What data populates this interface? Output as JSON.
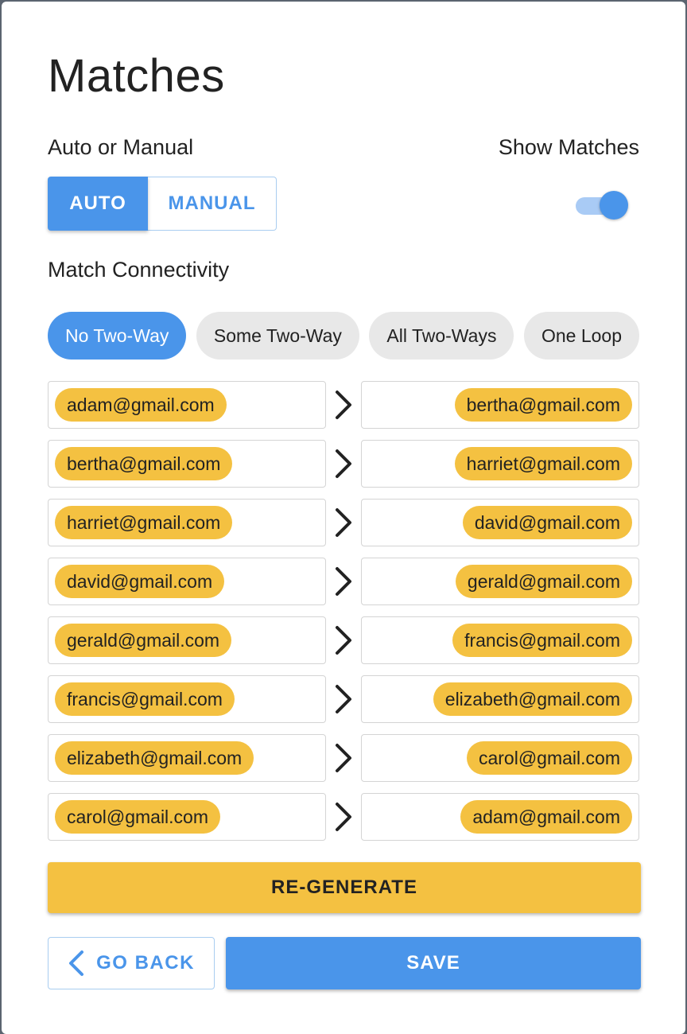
{
  "title": "Matches",
  "mode": {
    "label": "Auto or Manual",
    "auto_label": "AUTO",
    "manual_label": "MANUAL",
    "selected": "AUTO"
  },
  "show_matches": {
    "label": "Show Matches",
    "enabled": true
  },
  "connectivity": {
    "label": "Match Connectivity",
    "options": [
      "No Two-Way",
      "Some Two-Way",
      "All Two-Ways",
      "One Loop"
    ],
    "selected": "No Two-Way"
  },
  "matches": [
    {
      "from": "adam@gmail.com",
      "to": "bertha@gmail.com"
    },
    {
      "from": "bertha@gmail.com",
      "to": "harriet@gmail.com"
    },
    {
      "from": "harriet@gmail.com",
      "to": "david@gmail.com"
    },
    {
      "from": "david@gmail.com",
      "to": "gerald@gmail.com"
    },
    {
      "from": "gerald@gmail.com",
      "to": "francis@gmail.com"
    },
    {
      "from": "francis@gmail.com",
      "to": "elizabeth@gmail.com"
    },
    {
      "from": "elizabeth@gmail.com",
      "to": "carol@gmail.com"
    },
    {
      "from": "carol@gmail.com",
      "to": "adam@gmail.com"
    }
  ],
  "actions": {
    "regenerate_label": "RE-GENERATE",
    "go_back_label": "GO BACK",
    "save_label": "SAVE"
  },
  "colors": {
    "primary": "#4a95ea",
    "accent": "#f4c141",
    "chip_inactive": "#e8e8e8"
  },
  "icons": {
    "arrow": "chevron-right-icon",
    "back": "chevron-left-icon"
  }
}
